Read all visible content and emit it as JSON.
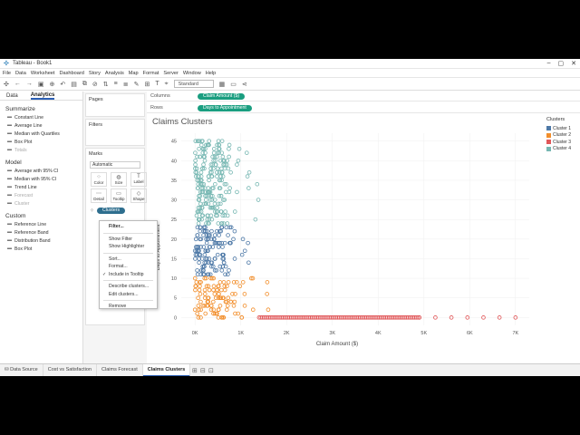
{
  "app": {
    "title": "Tableau - Book1"
  },
  "menu": [
    "File",
    "Data",
    "Worksheet",
    "Dashboard",
    "Story",
    "Analysis",
    "Map",
    "Format",
    "Server",
    "Window",
    "Help"
  ],
  "toolbar": {
    "fit": "Standard"
  },
  "left_panel": {
    "tabs": [
      "Data",
      "Analytics"
    ],
    "active_tab": "Analytics",
    "sections": [
      {
        "title": "Summarize",
        "items": [
          {
            "label": "Constant Line",
            "enabled": true
          },
          {
            "label": "Average Line",
            "enabled": true
          },
          {
            "label": "Median with Quartiles",
            "enabled": true
          },
          {
            "label": "Box Plot",
            "enabled": true
          },
          {
            "label": "Totals",
            "enabled": false
          }
        ]
      },
      {
        "title": "Model",
        "items": [
          {
            "label": "Average with 95% CI",
            "enabled": true
          },
          {
            "label": "Median with 95% CI",
            "enabled": true
          },
          {
            "label": "Trend Line",
            "enabled": true
          },
          {
            "label": "Forecast",
            "enabled": false
          },
          {
            "label": "Cluster",
            "enabled": false
          }
        ]
      },
      {
        "title": "Custom",
        "items": [
          {
            "label": "Reference Line",
            "enabled": true
          },
          {
            "label": "Reference Band",
            "enabled": true
          },
          {
            "label": "Distribution Band",
            "enabled": true
          },
          {
            "label": "Box Plot",
            "enabled": true
          }
        ]
      }
    ]
  },
  "cards": {
    "pages": "Pages",
    "filters": "Filters",
    "marks": "Marks",
    "marks_type": "Automatic",
    "mark_buttons": [
      "Color",
      "Size",
      "Label",
      "Detail",
      "Tooltip",
      "Shape"
    ],
    "clusters_pill": "Clusters"
  },
  "shelves": {
    "columns_label": "Columns",
    "columns_pill": "Claim Amount ($)",
    "rows_label": "Rows",
    "rows_pill": "Days to Appointment"
  },
  "context_menu": [
    {
      "label": "Filter...",
      "bold": true
    },
    {
      "sep": true
    },
    {
      "label": "Show Filter"
    },
    {
      "label": "Show Highlighter"
    },
    {
      "sep": true
    },
    {
      "label": "Sort..."
    },
    {
      "label": "Format..."
    },
    {
      "label": "Include in Tooltip",
      "checked": true
    },
    {
      "sep": true
    },
    {
      "label": "Describe clusters..."
    },
    {
      "label": "Edit clusters..."
    },
    {
      "sep": true
    },
    {
      "label": "Remove"
    }
  ],
  "legend": {
    "title": "Clusters",
    "items": [
      {
        "label": "Cluster 1",
        "color": "#4e79a7"
      },
      {
        "label": "Cluster 2",
        "color": "#f28e2b"
      },
      {
        "label": "Cluster 3",
        "color": "#e15759"
      },
      {
        "label": "Cluster 4",
        "color": "#76b7b2"
      }
    ]
  },
  "sheet_tabs": [
    "Data Source",
    "Cost vs Satisfaction",
    "Claims Forecast",
    "Claims Clusters"
  ],
  "active_sheet": "Claims Clusters",
  "chart_data": {
    "type": "scatter",
    "title": "Claims Clusters",
    "xlabel": "Claim Amount ($)",
    "ylabel": "Days to Appointment",
    "xlim": [
      -300,
      7300
    ],
    "ylim": [
      -2,
      47
    ],
    "x_ticks": [
      {
        "v": 0,
        "l": "0K"
      },
      {
        "v": 1000,
        "l": "1K"
      },
      {
        "v": 2000,
        "l": "2K"
      },
      {
        "v": 3000,
        "l": "3K"
      },
      {
        "v": 4000,
        "l": "4K"
      },
      {
        "v": 5000,
        "l": "5K"
      },
      {
        "v": 6000,
        "l": "6K"
      },
      {
        "v": 7000,
        "l": "7K"
      }
    ],
    "y_ticks": [
      0,
      5,
      10,
      15,
      20,
      25,
      30,
      35,
      40,
      45
    ],
    "series": [
      {
        "name": "Cluster 1",
        "color": "#4e79a7",
        "y_range": [
          11,
          23
        ],
        "x_range": [
          0,
          1000
        ],
        "out_x": 1000
      },
      {
        "name": "Cluster 2",
        "color": "#f28e2b",
        "y_range": [
          0,
          10
        ],
        "x_range": [
          0,
          1400
        ],
        "out_x": 1400
      },
      {
        "name": "Cluster 3",
        "color": "#e15759",
        "y_range": [
          0,
          0
        ],
        "x_range": [
          1400,
          7000
        ],
        "out_x": 7000
      },
      {
        "name": "Cluster 4",
        "color": "#76b7b2",
        "y_range": [
          24,
          45
        ],
        "x_range": [
          0,
          900
        ],
        "out_x": 1200
      }
    ]
  }
}
